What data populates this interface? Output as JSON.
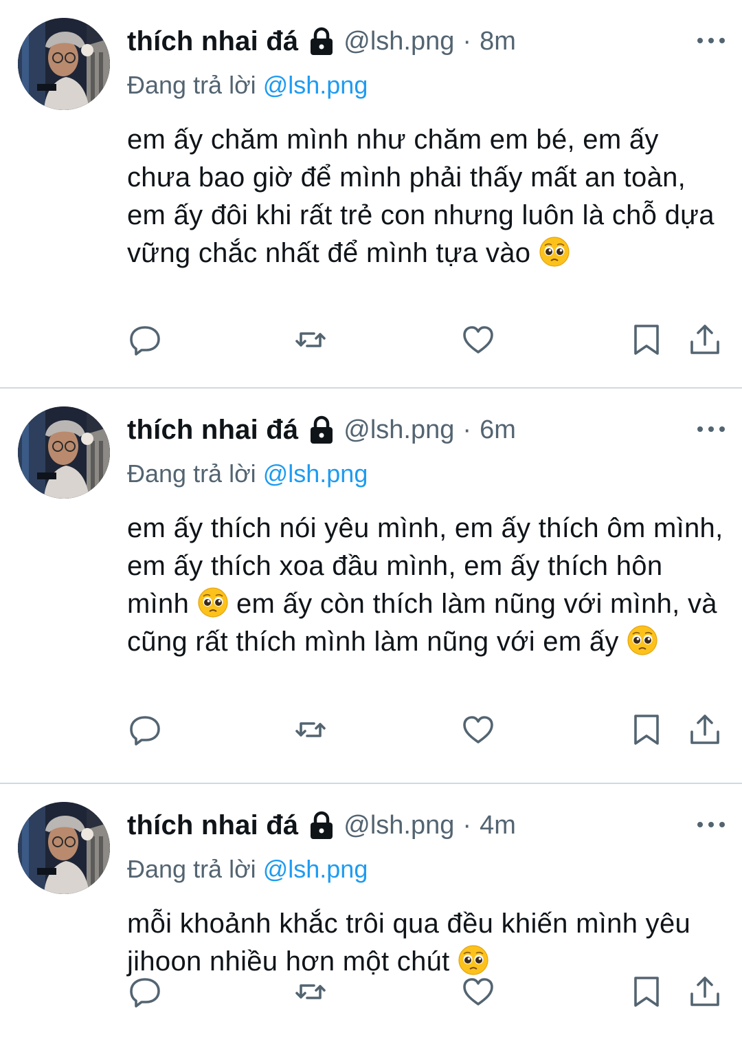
{
  "colors": {
    "text": "#0f1419",
    "muted": "#536471",
    "mention": "#1d9bf0",
    "divider": "#cfd9de"
  },
  "tweets": [
    {
      "author_name": "thích nhai đá",
      "handle": "@lsh.png",
      "separator": "·",
      "time": "8m",
      "replying_prefix": "Đang trả lời",
      "replying_to": "@lsh.png",
      "text_segments": [
        "em ấy chăm mình như chăm em bé, em ấy chưa bao giờ để mình phải thấy mất an toàn, em ấy đôi khi rất trẻ con nhưng luôn là chỗ dựa vững chắc nhất để mình tựa vào"
      ],
      "emoji": "pleading-face"
    },
    {
      "author_name": "thích nhai đá",
      "handle": "@lsh.png",
      "separator": "·",
      "time": "6m",
      "replying_prefix": "Đang trả lời",
      "replying_to": "@lsh.png",
      "text_segments": [
        "em ấy thích nói yêu mình, em ấy thích ôm mình, em ấy thích xoa đầu mình, em ấy thích hôn mình",
        "em ấy còn thích làm nũng với mình, và cũng rất thích mình làm nũng với em ấy"
      ],
      "emoji": "pleading-face"
    },
    {
      "author_name": "thích nhai đá",
      "handle": "@lsh.png",
      "separator": "·",
      "time": "4m",
      "replying_prefix": "Đang trả lời",
      "replying_to": "@lsh.png",
      "text_segments": [
        "mỗi khoảnh khắc trôi qua đều khiến mình yêu jihoon nhiều hơn một chút"
      ],
      "emoji": "pleading-face"
    }
  ],
  "icons": {
    "lock": "lock-icon",
    "more": "more-options-icon",
    "reply": "reply-icon",
    "retweet": "retweet-icon",
    "like": "heart-icon",
    "bookmark": "bookmark-icon",
    "share": "share-icon"
  }
}
